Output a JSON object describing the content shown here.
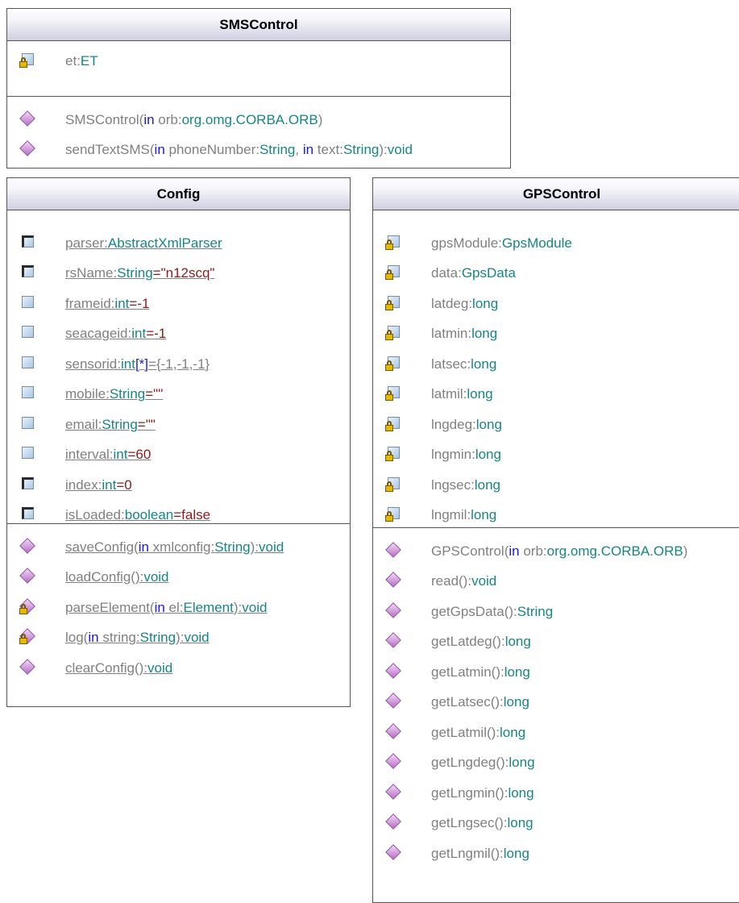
{
  "sms": {
    "name": "SMSControl",
    "attributes": [
      {
        "name": "et",
        "type": "ET"
      }
    ],
    "operations": [
      {
        "parts": [
          [
            "nm",
            "SMSControl("
          ],
          [
            "kw",
            "in"
          ],
          [
            "nm",
            " orb:"
          ],
          [
            "ty",
            "org.omg.CORBA.ORB"
          ],
          [
            "nm",
            ")"
          ]
        ]
      },
      {
        "parts": [
          [
            "nm",
            "sendTextSMS("
          ],
          [
            "kw",
            "in"
          ],
          [
            "nm",
            " phoneNumber:"
          ],
          [
            "ty",
            "String"
          ],
          [
            "nm",
            ", "
          ],
          [
            "kw",
            "in"
          ],
          [
            "nm",
            " text:"
          ],
          [
            "ty",
            "String"
          ],
          [
            "nm",
            "):"
          ],
          [
            "ty",
            "void"
          ]
        ]
      }
    ]
  },
  "config": {
    "name": "Config",
    "attributes": [
      {
        "vis": "protected",
        "parts": [
          [
            "nm",
            "parser:"
          ],
          [
            "ty",
            "AbstractXmlParser"
          ]
        ]
      },
      {
        "vis": "protected",
        "parts": [
          [
            "nm",
            "rsName:"
          ],
          [
            "ty",
            "String"
          ],
          [
            "dv",
            "=\"n12scq\""
          ]
        ]
      },
      {
        "vis": "public",
        "parts": [
          [
            "nm",
            "frameid:"
          ],
          [
            "ty",
            "int"
          ],
          [
            "dv",
            "=-1"
          ]
        ]
      },
      {
        "vis": "public",
        "parts": [
          [
            "nm",
            "seacageid:"
          ],
          [
            "ty",
            "int"
          ],
          [
            "dv",
            "=-1"
          ]
        ]
      },
      {
        "vis": "public",
        "parts": [
          [
            "nm",
            "sensorid:"
          ],
          [
            "ty",
            "int"
          ],
          [
            "kw",
            "[*]"
          ],
          [
            "nm",
            "={-1,-1,-1}"
          ]
        ]
      },
      {
        "vis": "public",
        "parts": [
          [
            "nm",
            "mobile:"
          ],
          [
            "ty",
            "String"
          ],
          [
            "dv",
            "=\"\""
          ]
        ]
      },
      {
        "vis": "public",
        "parts": [
          [
            "nm",
            "email:"
          ],
          [
            "ty",
            "String"
          ],
          [
            "dv",
            "=\"\""
          ]
        ]
      },
      {
        "vis": "public",
        "parts": [
          [
            "nm",
            "interval:"
          ],
          [
            "ty",
            "int"
          ],
          [
            "dv",
            "=60"
          ]
        ]
      },
      {
        "vis": "protected",
        "parts": [
          [
            "nm",
            "index:"
          ],
          [
            "ty",
            "int"
          ],
          [
            "dv",
            "=0"
          ]
        ]
      },
      {
        "vis": "protected",
        "parts": [
          [
            "nm",
            "isLoaded:"
          ],
          [
            "ty",
            "boolean"
          ],
          [
            "dv",
            "=false"
          ]
        ]
      }
    ],
    "operations": [
      {
        "vis": "public",
        "parts": [
          [
            "nm",
            "saveConfig("
          ],
          [
            "kw",
            "in"
          ],
          [
            "nm",
            " xmlconfig:"
          ],
          [
            "ty",
            "String"
          ],
          [
            "nm",
            "):"
          ],
          [
            "ty",
            "void"
          ]
        ]
      },
      {
        "vis": "public",
        "parts": [
          [
            "nm",
            "loadConfig():"
          ],
          [
            "ty",
            "void"
          ]
        ]
      },
      {
        "vis": "private",
        "parts": [
          [
            "nm",
            "parseElement("
          ],
          [
            "kw",
            "in"
          ],
          [
            "nm",
            " el:"
          ],
          [
            "ty",
            "Element"
          ],
          [
            "nm",
            "):"
          ],
          [
            "ty",
            "void"
          ]
        ]
      },
      {
        "vis": "private",
        "parts": [
          [
            "nm",
            "log("
          ],
          [
            "kw",
            "in"
          ],
          [
            "nm",
            " string:"
          ],
          [
            "ty",
            "String"
          ],
          [
            "nm",
            "):"
          ],
          [
            "ty",
            "void"
          ]
        ]
      },
      {
        "vis": "public",
        "parts": [
          [
            "nm",
            "clearConfig():"
          ],
          [
            "ty",
            "void"
          ]
        ]
      }
    ]
  },
  "gps": {
    "name": "GPSControl",
    "attributes": [
      {
        "parts": [
          [
            "nm",
            "gpsModule:"
          ],
          [
            "ty",
            "GpsModule"
          ]
        ]
      },
      {
        "parts": [
          [
            "nm",
            "data:"
          ],
          [
            "ty",
            "GpsData"
          ]
        ]
      },
      {
        "parts": [
          [
            "nm",
            "latdeg:"
          ],
          [
            "ty",
            "long"
          ]
        ]
      },
      {
        "parts": [
          [
            "nm",
            "latmin:"
          ],
          [
            "ty",
            "long"
          ]
        ]
      },
      {
        "parts": [
          [
            "nm",
            "latsec:"
          ],
          [
            "ty",
            "long"
          ]
        ]
      },
      {
        "parts": [
          [
            "nm",
            "latmil:"
          ],
          [
            "ty",
            "long"
          ]
        ]
      },
      {
        "parts": [
          [
            "nm",
            "lngdeg:"
          ],
          [
            "ty",
            "long"
          ]
        ]
      },
      {
        "parts": [
          [
            "nm",
            "lngmin:"
          ],
          [
            "ty",
            "long"
          ]
        ]
      },
      {
        "parts": [
          [
            "nm",
            "lngsec:"
          ],
          [
            "ty",
            "long"
          ]
        ]
      },
      {
        "parts": [
          [
            "nm",
            "lngmil:"
          ],
          [
            "ty",
            "long"
          ]
        ]
      }
    ],
    "operations": [
      {
        "parts": [
          [
            "nm",
            "GPSControl("
          ],
          [
            "kw",
            "in"
          ],
          [
            "nm",
            " orb:"
          ],
          [
            "ty",
            "org.omg.CORBA.ORB"
          ],
          [
            "nm",
            ")"
          ]
        ]
      },
      {
        "parts": [
          [
            "nm",
            "read():"
          ],
          [
            "ty",
            "void"
          ]
        ]
      },
      {
        "parts": [
          [
            "nm",
            "getGpsData():"
          ],
          [
            "ty",
            "String"
          ]
        ]
      },
      {
        "parts": [
          [
            "nm",
            "getLatdeg():"
          ],
          [
            "ty",
            "long"
          ]
        ]
      },
      {
        "parts": [
          [
            "nm",
            "getLatmin():"
          ],
          [
            "ty",
            "long"
          ]
        ]
      },
      {
        "parts": [
          [
            "nm",
            "getLatsec():"
          ],
          [
            "ty",
            "long"
          ]
        ]
      },
      {
        "parts": [
          [
            "nm",
            "getLatmil():"
          ],
          [
            "ty",
            "long"
          ]
        ]
      },
      {
        "parts": [
          [
            "nm",
            "getLngdeg():"
          ],
          [
            "ty",
            "long"
          ]
        ]
      },
      {
        "parts": [
          [
            "nm",
            "getLngmin():"
          ],
          [
            "ty",
            "long"
          ]
        ]
      },
      {
        "parts": [
          [
            "nm",
            "getLngsec():"
          ],
          [
            "ty",
            "long"
          ]
        ]
      },
      {
        "parts": [
          [
            "nm",
            "getLngmil():"
          ],
          [
            "ty",
            "long"
          ]
        ]
      }
    ]
  }
}
